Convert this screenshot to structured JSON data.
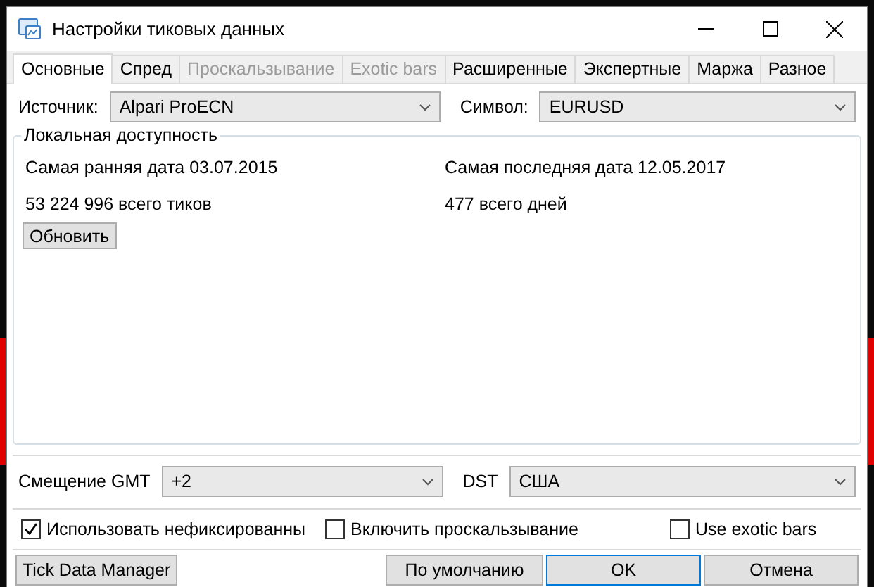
{
  "window": {
    "title": "Настройки тиковых данных"
  },
  "tabs": [
    {
      "label": "Основные",
      "selected": true,
      "disabled": false
    },
    {
      "label": "Спред",
      "selected": false,
      "disabled": false
    },
    {
      "label": "Проскальзывание",
      "selected": false,
      "disabled": true
    },
    {
      "label": "Exotic bars",
      "selected": false,
      "disabled": true
    },
    {
      "label": "Расширенные",
      "selected": false,
      "disabled": false
    },
    {
      "label": "Экспертные",
      "selected": false,
      "disabled": false
    },
    {
      "label": "Маржа",
      "selected": false,
      "disabled": false
    },
    {
      "label": "Разное",
      "selected": false,
      "disabled": false
    }
  ],
  "source": {
    "label": "Источник:",
    "value": "Alpari ProECN"
  },
  "symbol": {
    "label": "Символ:",
    "value": "EURUSD"
  },
  "local_availability": {
    "title": "Локальная доступность",
    "earliest": "Самая ранняя дата 03.07.2015",
    "latest": "Самая последняя дата 12.05.2017",
    "ticks": "53 224 996 всего тиков",
    "days": "477 всего дней",
    "refresh_button": "Обновить"
  },
  "gmt_offset": {
    "label": "Смещение GMT",
    "value": "+2"
  },
  "dst": {
    "label": "DST",
    "value": "США"
  },
  "options": [
    {
      "label": "Использовать нефиксированны",
      "checked": true
    },
    {
      "label": "Включить проскальзывание",
      "checked": false
    },
    {
      "label": "Use exotic bars",
      "checked": false
    }
  ],
  "buttons": {
    "left": "Tick Data Manager",
    "default": "По умолчанию",
    "ok": "OK",
    "cancel": "Отмена"
  }
}
